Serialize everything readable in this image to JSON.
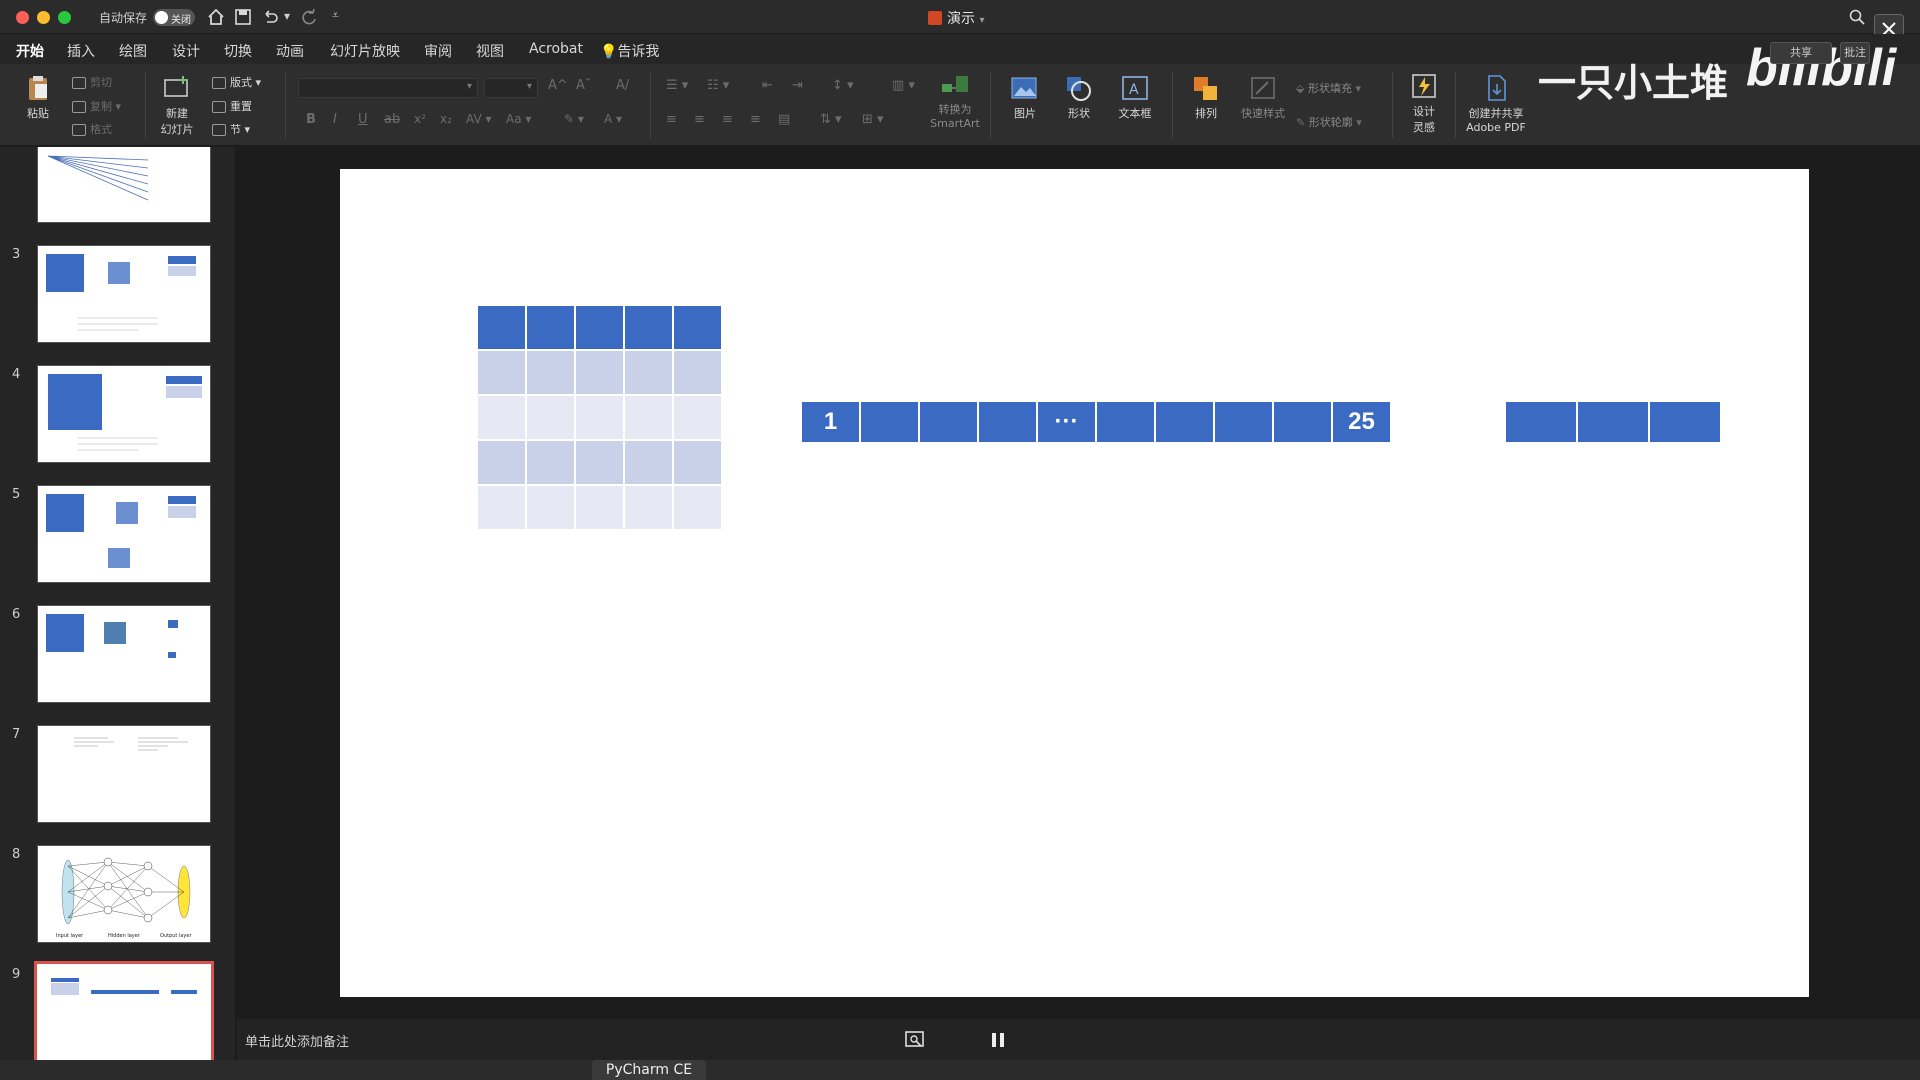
{
  "titlebar": {
    "autosave_label": "自动保存",
    "autosave_state": "关闭",
    "doc_title": "演示"
  },
  "tabs": [
    "开始",
    "插入",
    "绘图",
    "设计",
    "切换",
    "动画",
    "幻灯片放映",
    "审阅",
    "视图",
    "Acrobat"
  ],
  "tell_me": "告诉我",
  "ribbon": {
    "paste": "粘贴",
    "cut": "剪切",
    "copy": "复制",
    "format": "格式",
    "new_slide_1": "新建",
    "new_slide_2": "幻灯片",
    "layout": "版式",
    "reset": "重置",
    "section": "节",
    "convert_1": "转换为",
    "convert_2": "SmartArt",
    "picture": "图片",
    "shape": "形状",
    "textbox": "文本框",
    "arrange": "排列",
    "quick_styles": "快速样式",
    "shape_fill": "形状填充",
    "shape_outline": "形状轮廓",
    "design_ideas_1": "设计",
    "design_ideas_2": "灵感",
    "create_pdf_1": "创建并共享",
    "create_pdf_2": "Adobe PDF",
    "share": "共享",
    "comments": "批注"
  },
  "watermark": {
    "text": "一只小土堆",
    "logo": "bilibili"
  },
  "thumbnails": [
    {
      "num": "3"
    },
    {
      "num": "4"
    },
    {
      "num": "5"
    },
    {
      "num": "6"
    },
    {
      "num": "7"
    },
    {
      "num": "8"
    },
    {
      "num": "9"
    }
  ],
  "thumb8_labels": [
    "Input layer",
    "Hidden layer",
    "Output layer"
  ],
  "slide": {
    "sequence_first": "1",
    "sequence_ellipsis": "···",
    "sequence_last": "25",
    "colors": {
      "dark": "#3a6ac2",
      "mid": "#c9d1e8",
      "light": "#e6e9f3"
    }
  },
  "notes_placeholder": "单击此处添加备注",
  "taskbar_app": "PyCharm CE",
  "colors": {
    "selection": "#d9534f",
    "accent": "#3a6ac2"
  }
}
